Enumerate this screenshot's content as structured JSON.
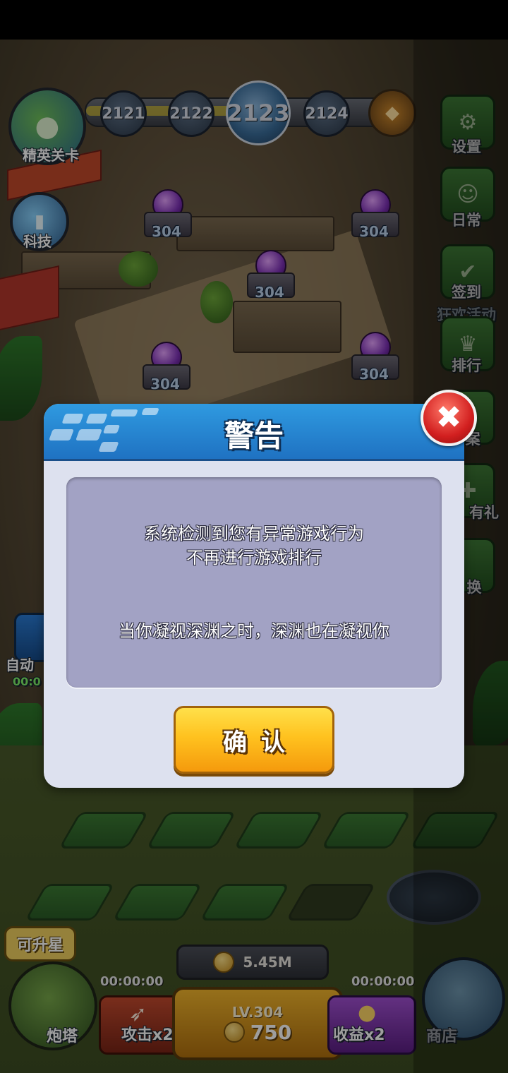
{
  "level_track": {
    "levels": [
      "2121",
      "2122",
      "2123",
      "2124"
    ],
    "current_level": "2123"
  },
  "left_menu": {
    "elite_stage_label": "精英关卡",
    "tech_label": "科技",
    "auto_label": "自动",
    "auto_timer": "00:0"
  },
  "side_menu": {
    "settings": "设置",
    "daily": "日常",
    "checkin": "签到",
    "carnival": "狂欢活动",
    "ranking": "排行",
    "archive_partial": "案",
    "gift_partial": "有礼",
    "exchange_partial": "换"
  },
  "towers": {
    "level_label": "304"
  },
  "bottom": {
    "coins": "5.45M",
    "timer_left": "00:00:00",
    "timer_right": "00:00:00",
    "upgrade_level": "LV.304",
    "upgrade_cost": "750",
    "turret_label": "炮塔",
    "attack_label": "攻击x2",
    "income_label": "收益x2",
    "shop_label": "商店",
    "star_badge": "可升星"
  },
  "dialog": {
    "title": "警告",
    "message_line1": "系统检测到您有异常游戏行为",
    "message_line2": "不再进行游戏排行",
    "message_line3": "当你凝视深渊之时，深渊也在凝视你",
    "confirm_label": "确认",
    "close_symbol": "✖"
  },
  "colors": {
    "dialog_header": "#2f9ae0",
    "confirm_button": "#ffc21f",
    "close_button": "#d21f1f",
    "message_box": "#a2a2c4"
  }
}
